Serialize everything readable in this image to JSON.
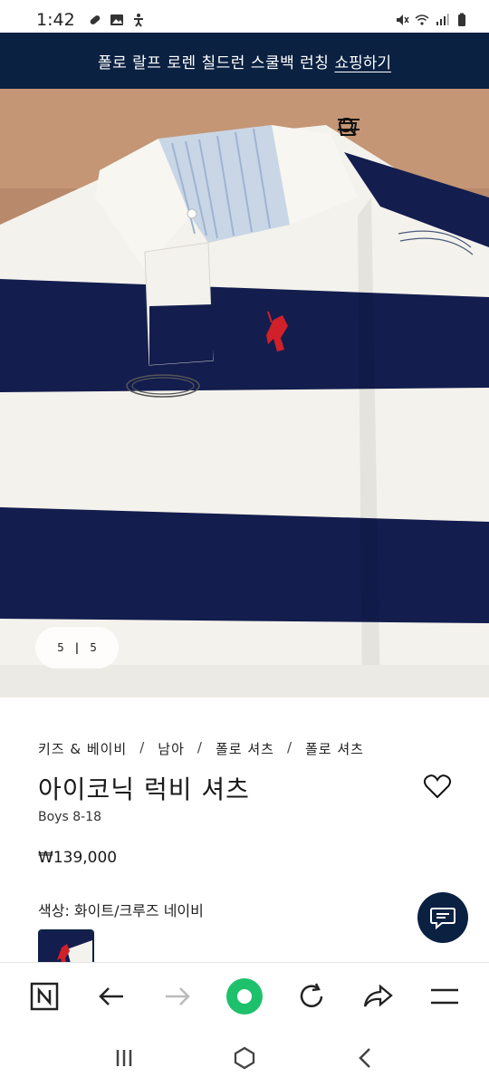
{
  "status_bar": {
    "time": "1:42",
    "left_icons": [
      "pill-icon",
      "image-icon",
      "accessibility-icon"
    ],
    "right_icons": [
      "mute-icon",
      "wifi-icon",
      "signal-icon",
      "battery-icon"
    ]
  },
  "promo": {
    "text": "폴로 랄프 로렌 칠드런 스쿨백 런칭",
    "link": "쇼핑하기"
  },
  "hero": {
    "counter_current": "5",
    "counter_separator": "|",
    "counter_total": "5",
    "actions": [
      "search-icon",
      "shopping-bag-icon",
      "menu-icon"
    ]
  },
  "breadcrumb": {
    "items": [
      "키즈 & 베이비",
      "남아",
      "폴로 셔츠",
      "폴로 셔츠"
    ],
    "separator": "/"
  },
  "product": {
    "title": "아이코닉 럭비 셔츠",
    "subtitle": "Boys 8-18",
    "price": "₩139,000",
    "color_label": "색상: 화이트/크루즈 네이비"
  },
  "browser_toolbar": [
    "naver-n-icon",
    "back-arrow-icon",
    "forward-arrow-icon",
    "green-home-icon",
    "refresh-icon",
    "share-icon",
    "hamburger-icon"
  ],
  "system_nav": [
    "recent-apps-icon",
    "home-icon",
    "back-icon"
  ],
  "colors": {
    "navy": "#0b2142",
    "stripe_navy": "#131d4e",
    "stripe_white": "#f4f2ec",
    "pony_red": "#d0202a",
    "browser_green": "#1ec16b"
  }
}
